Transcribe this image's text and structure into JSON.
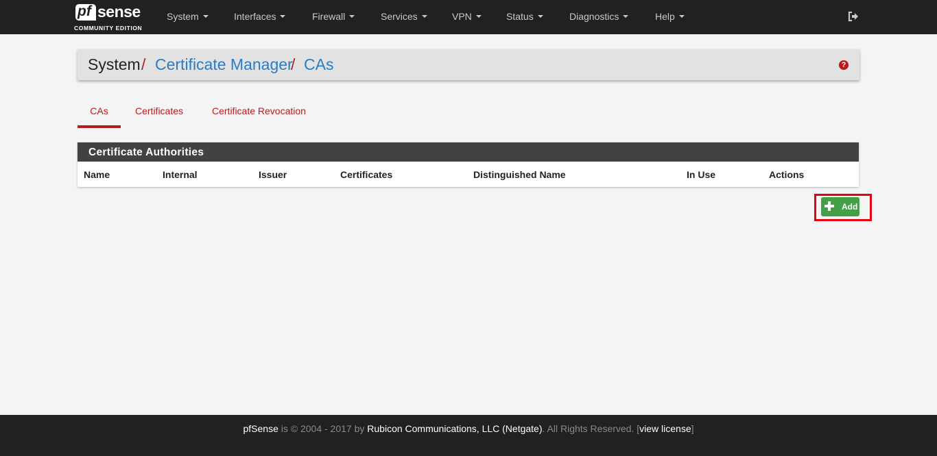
{
  "brand": {
    "name_prefix": "pf",
    "name_suffix": "sense",
    "edition": "COMMUNITY EDITION"
  },
  "nav": {
    "items": [
      {
        "label": "System"
      },
      {
        "label": "Interfaces"
      },
      {
        "label": "Firewall"
      },
      {
        "label": "Services"
      },
      {
        "label": "VPN"
      },
      {
        "label": "Status"
      },
      {
        "label": "Diagnostics"
      },
      {
        "label": "Help"
      }
    ]
  },
  "breadcrumb": {
    "root": "System",
    "separator": "/",
    "level2": "Certificate Manager",
    "level3": "CAs",
    "help_glyph": "?"
  },
  "tabs": [
    {
      "label": "CAs",
      "active": true
    },
    {
      "label": "Certificates",
      "active": false
    },
    {
      "label": "Certificate Revocation",
      "active": false
    }
  ],
  "panel": {
    "title": "Certificate Authorities",
    "columns": [
      "Name",
      "Internal",
      "Issuer",
      "Certificates",
      "Distinguished Name",
      "In Use",
      "Actions"
    ]
  },
  "actions": {
    "add_label": "Add"
  },
  "footer": {
    "product": "pfSense",
    "is": "is",
    "copyright": "© 2004 - 2017 by",
    "company": "Rubicon Communications, LLC (Netgate)",
    "rights": ". All Rights Reserved. [",
    "license_link": "view license",
    "close_bracket": "]"
  },
  "colors": {
    "navbar_bg": "#212121",
    "accent_red": "#b71c1c",
    "link_blue": "#2a7dc5",
    "panel_heading_bg": "#424242",
    "success_green": "#43a047",
    "highlight_red": "#e3000f"
  },
  "icons": {
    "logout": "logout-icon",
    "help": "question-circle-icon",
    "add": "plus-icon",
    "dropdown": "caret-down-icon"
  }
}
